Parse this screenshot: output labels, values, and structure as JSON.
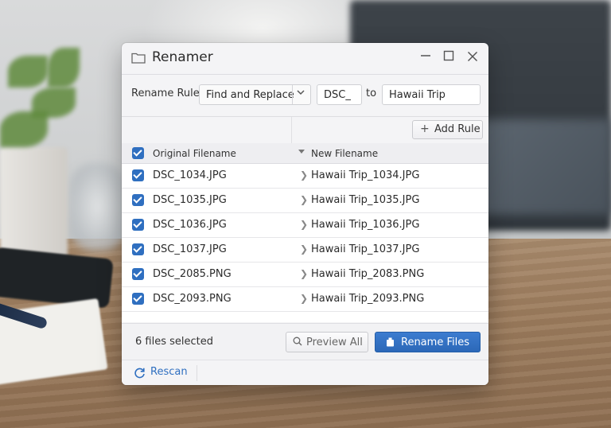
{
  "window": {
    "title": "Renamer"
  },
  "rule": {
    "label": "Rename Rule:",
    "mode": "Find and Replace",
    "find": "DSC_",
    "to_label": "to",
    "replace": "Hawaii Trip",
    "add_rule_label": "Add Rule"
  },
  "table": {
    "header_original": "Original Filename",
    "header_new": "New Filename",
    "rows": [
      {
        "original": "DSC_1034.JPG",
        "new": "Hawaii Trip_1034.JPG"
      },
      {
        "original": "DSC_1035.JPG",
        "new": "Hawaii Trip_1035.JPG"
      },
      {
        "original": "DSC_1036.JPG",
        "new": "Hawaii Trip_1036.JPG"
      },
      {
        "original": "DSC_1037.JPG",
        "new": "Hawaii Trip_1037.JPG"
      },
      {
        "original": "DSC_2085.PNG",
        "new": "Hawaii Trip_2083.PNG"
      },
      {
        "original": "DSC_2093.PNG",
        "new": "Hawaii Trip_2093.PNG"
      }
    ]
  },
  "footer": {
    "selected_text": "6 files selected",
    "preview_label": "Preview All",
    "rename_label": "Rename Files"
  },
  "bottom": {
    "rescan_label": "Rescan"
  },
  "colors": {
    "accent": "#2f6fc0",
    "dialog_bg": "#f4f4f6"
  },
  "icons": [
    "folder-icon",
    "minimize-icon",
    "maximize-icon",
    "close-icon",
    "chevron-down-icon",
    "plus-icon",
    "checkbox-icon",
    "sort-down-icon",
    "chevron-right-icon",
    "search-icon",
    "rename-icon",
    "refresh-icon"
  ]
}
